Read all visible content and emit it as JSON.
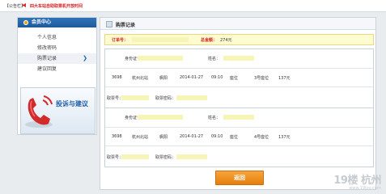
{
  "notice": {
    "label": "【公告栏】",
    "text": "四大车站自助取票机开放时间"
  },
  "sidebar": {
    "title": "会员中心",
    "items": [
      {
        "label": "个人信息"
      },
      {
        "label": "修改密码"
      },
      {
        "label": "购票记录"
      },
      {
        "label": "建议回复"
      }
    ],
    "complaint_label": "投诉与建议"
  },
  "main": {
    "title": "购票记录",
    "summary": {
      "order_label": "订单号：",
      "total_label": "总金额：",
      "total_value": "274元"
    },
    "tickets": [
      {
        "id_label": "身份证号：",
        "name_label": "姓名：",
        "train": "3698",
        "from": "杭州北站",
        "to": "枫阳",
        "date": "2014-01-27",
        "time": "09:10",
        "seat_type": "座位",
        "seat_no": "3号座位",
        "price": "137元",
        "ticket_no_label": "取票号：",
        "ticket_pwd_label": "取票密码："
      },
      {
        "id_label": "身份证号：",
        "name_label": "姓名：",
        "train": "3698",
        "from": "杭州北站",
        "to": "枫阳",
        "date": "2014-01-27",
        "time": "09:10",
        "seat_type": "座位",
        "seat_no": "4号座位",
        "price": "137元",
        "ticket_no_label": "取票号：",
        "ticket_pwd_label": "取票密码："
      }
    ],
    "back_label": "返回"
  },
  "watermark": {
    "main": "19楼 杭州",
    "sub": "www.19lou.com"
  },
  "colors": {
    "accent": "#1e5ea8",
    "alert": "#d42020",
    "button": "#f29a2e",
    "highlight": "#fffbd0"
  }
}
